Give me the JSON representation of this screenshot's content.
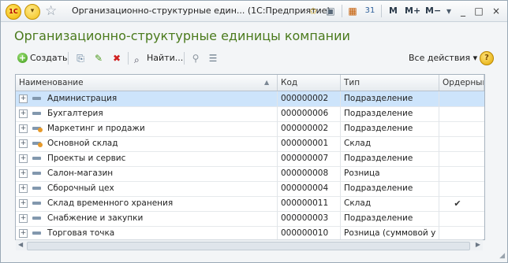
{
  "titlebar": {
    "logo_text": "1С",
    "title": "Организационно-структурные един... (1С:Предприятие)",
    "memory_buttons": [
      "M",
      "M+",
      "M−"
    ]
  },
  "form": {
    "title": "Организационно-структурные единицы компании"
  },
  "toolbar": {
    "create_label": "Создать",
    "find_label": "Найти...",
    "all_actions_label": "Все действия ▾",
    "help_label": "?"
  },
  "table": {
    "headers": {
      "name": "Наименование",
      "code": "Код",
      "type": "Тип",
      "ordered": "Ордерный"
    },
    "rows": [
      {
        "name": "Администрация",
        "code": "000000002",
        "type": "Подразделение",
        "ordered": "",
        "icon": "subdivision-icon"
      },
      {
        "name": "Бухгалтерия",
        "code": "000000006",
        "type": "Подразделение",
        "ordered": "",
        "icon": "subdivision-icon"
      },
      {
        "name": "Маркетинг и продажи",
        "code": "000000002",
        "type": "Подразделение",
        "ordered": "",
        "icon": "subdivision-warehouse-icon"
      },
      {
        "name": "Основной склад",
        "code": "000000001",
        "type": "Склад",
        "ordered": "",
        "icon": "warehouse-icon"
      },
      {
        "name": "Проекты и сервис",
        "code": "000000007",
        "type": "Подразделение",
        "ordered": "",
        "icon": "subdivision-icon"
      },
      {
        "name": "Салон-магазин",
        "code": "000000008",
        "type": "Розница",
        "ordered": "",
        "icon": "subdivision-icon"
      },
      {
        "name": "Сборочный цех",
        "code": "000000004",
        "type": "Подразделение",
        "ordered": "",
        "icon": "subdivision-icon"
      },
      {
        "name": "Склад временного хранения",
        "code": "000000011",
        "type": "Склад",
        "ordered": "✔",
        "icon": "subdivision-icon"
      },
      {
        "name": "Снабжение и закупки",
        "code": "000000003",
        "type": "Подразделение",
        "ordered": "",
        "icon": "subdivision-icon"
      },
      {
        "name": "Торговая точка",
        "code": "000000010",
        "type": "Розница (суммовой у",
        "ordered": "",
        "icon": "subdivision-icon"
      }
    ]
  },
  "colors": {
    "title_green": "#4a7a1c",
    "selection": "#cde4fb"
  }
}
